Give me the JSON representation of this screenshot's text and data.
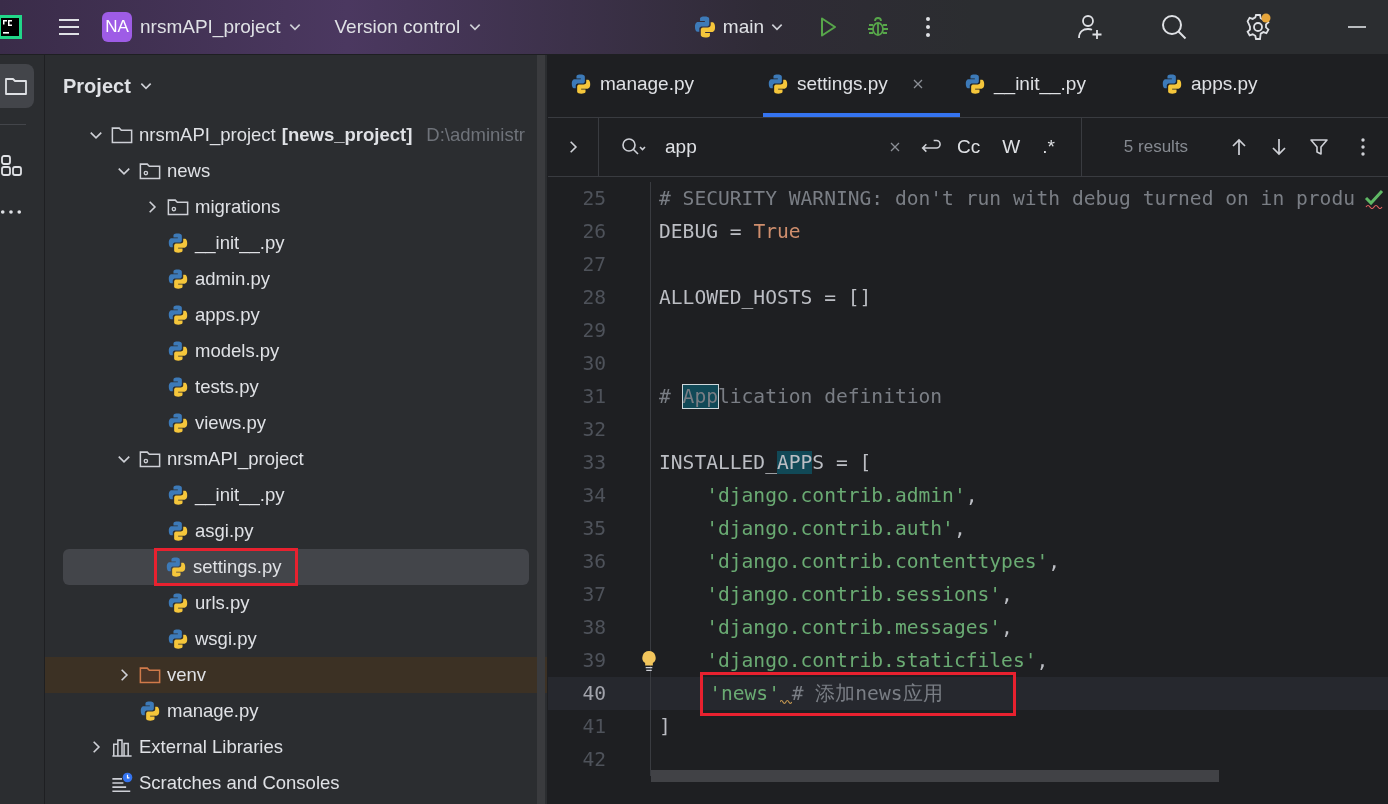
{
  "title_bar": {
    "project_badge": "NA",
    "project": "nrsmAPI_project",
    "vcs": "Version control",
    "run_config": "main"
  },
  "project_panel": {
    "title": "Project",
    "tree": [
      {
        "kind": "project",
        "name": "nrsmAPI_project",
        "module": "[news_project]",
        "path": "D:\\administr",
        "expanded": true,
        "children": [
          {
            "kind": "package",
            "name": "news",
            "expanded": true,
            "children": [
              {
                "kind": "package",
                "name": "migrations",
                "expanded": false
              },
              {
                "kind": "python",
                "name": "__init__.py"
              },
              {
                "kind": "python",
                "name": "admin.py"
              },
              {
                "kind": "python",
                "name": "apps.py"
              },
              {
                "kind": "python",
                "name": "models.py"
              },
              {
                "kind": "python",
                "name": "tests.py"
              },
              {
                "kind": "python",
                "name": "views.py"
              }
            ]
          },
          {
            "kind": "package",
            "name": "nrsmAPI_project",
            "expanded": true,
            "children": [
              {
                "kind": "python",
                "name": "__init__.py"
              },
              {
                "kind": "python",
                "name": "asgi.py"
              },
              {
                "kind": "python",
                "name": "settings.py",
                "selected": true,
                "annotated": true
              },
              {
                "kind": "python",
                "name": "urls.py"
              },
              {
                "kind": "python",
                "name": "wsgi.py"
              }
            ]
          },
          {
            "kind": "folder",
            "name": "venv",
            "expanded": false,
            "excluded": true
          },
          {
            "kind": "python",
            "name": "manage.py"
          }
        ]
      },
      {
        "kind": "libraries",
        "name": "External Libraries",
        "expanded": false
      },
      {
        "kind": "scratches",
        "name": "Scratches and Consoles"
      }
    ]
  },
  "editor_tabs": [
    {
      "label": "manage.py",
      "selected": false
    },
    {
      "label": "settings.py",
      "selected": true
    },
    {
      "label": "__init__.py",
      "selected": false
    },
    {
      "label": "apps.py",
      "selected": false
    }
  ],
  "find_bar": {
    "query": "app",
    "toggles": [
      "Cc",
      "W",
      ".*"
    ],
    "results": "5 results"
  },
  "code": [
    {
      "number": "25",
      "segments": [
        {
          "text": "# SECURITY WARNING: don't run with debug turned on in produ",
          "kind": "comment"
        }
      ]
    },
    {
      "number": "26",
      "segments": [
        {
          "text": "DEBUG = ",
          "kind": "plain"
        },
        {
          "text": "True",
          "kind": "const"
        }
      ]
    },
    {
      "number": "27"
    },
    {
      "number": "28",
      "segments": [
        {
          "text": "ALLOWED_HOSTS = []",
          "kind": "plain"
        }
      ]
    },
    {
      "number": "29"
    },
    {
      "number": "30"
    },
    {
      "number": "31",
      "segments": [
        {
          "text": "# ",
          "kind": "comment"
        },
        {
          "text": "App",
          "kind": "match_current"
        },
        {
          "text": "lication definition",
          "kind": "comment"
        }
      ]
    },
    {
      "number": "32"
    },
    {
      "number": "33",
      "segments": [
        {
          "text": "INSTALLED_",
          "kind": "plain"
        },
        {
          "text": "APP",
          "kind": "match"
        },
        {
          "text": "S = [",
          "kind": "plain"
        }
      ]
    },
    {
      "number": "34",
      "indented": true,
      "segments": [
        {
          "text": "'django.contrib.admin'",
          "kind": "string"
        },
        {
          "text": ",",
          "kind": "plain"
        }
      ]
    },
    {
      "number": "35",
      "indented": true,
      "segments": [
        {
          "text": "'django.contrib.auth'",
          "kind": "string"
        },
        {
          "text": ",",
          "kind": "plain"
        }
      ]
    },
    {
      "number": "36",
      "indented": true,
      "segments": [
        {
          "text": "'django.contrib.contenttypes'",
          "kind": "string"
        },
        {
          "text": ",",
          "kind": "plain"
        }
      ]
    },
    {
      "number": "37",
      "indented": true,
      "segments": [
        {
          "text": "'django.contrib.sessions'",
          "kind": "string"
        },
        {
          "text": ",",
          "kind": "plain"
        }
      ]
    },
    {
      "number": "38",
      "indented": true,
      "segments": [
        {
          "text": "'django.contrib.messages'",
          "kind": "string"
        },
        {
          "text": ",",
          "kind": "plain"
        }
      ]
    },
    {
      "number": "39",
      "indented": true,
      "bulb": true,
      "segments": [
        {
          "text": "'django.contrib.staticfiles'",
          "kind": "string"
        },
        {
          "text": ",",
          "kind": "plain"
        }
      ]
    },
    {
      "number": "40",
      "indented": true,
      "current": true,
      "annotated": true,
      "segments": [
        {
          "text": "'news'",
          "kind": "string",
          "warning": true
        },
        {
          "text": "# 添加news应用",
          "kind": "comment"
        }
      ]
    },
    {
      "number": "41",
      "segments": [
        {
          "text": "]",
          "kind": "plain"
        }
      ]
    },
    {
      "number": "42"
    }
  ]
}
